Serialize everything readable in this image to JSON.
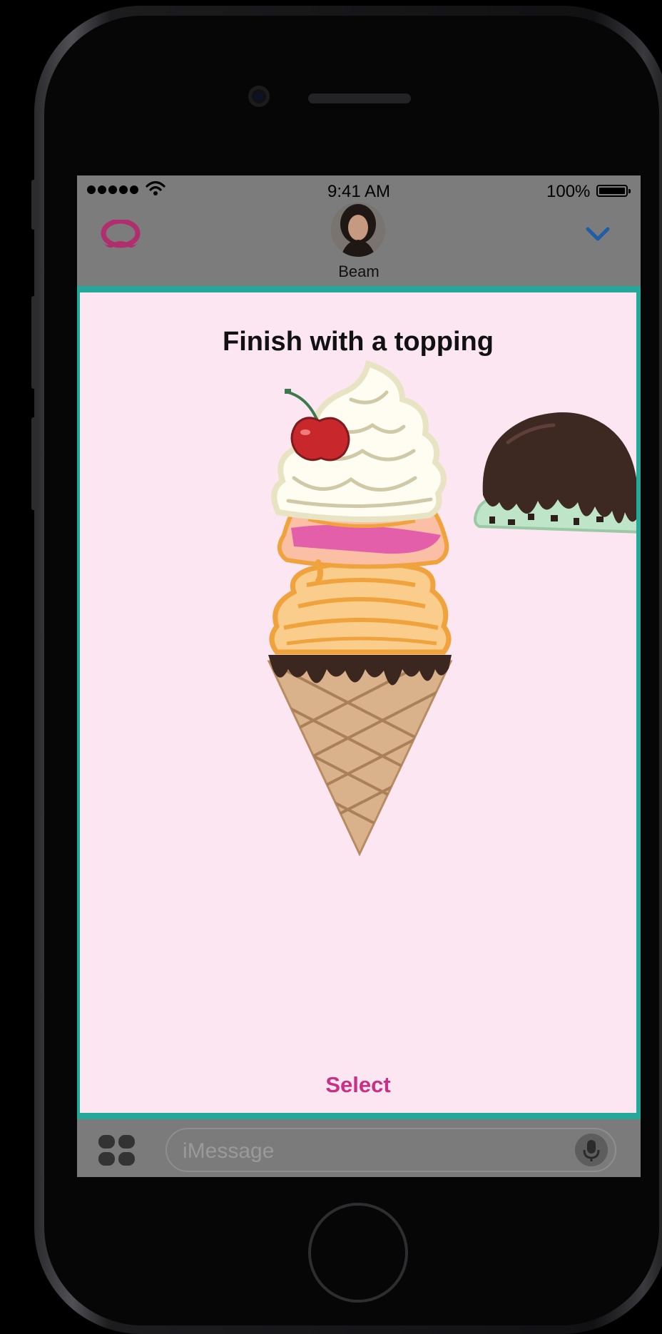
{
  "status_bar": {
    "time": "9:41 AM",
    "battery": "100%"
  },
  "header": {
    "contact_name": "Beam"
  },
  "panel": {
    "title": "Finish with a topping",
    "select_label": "Select"
  },
  "input_bar": {
    "placeholder": "iMessage"
  },
  "icons": {
    "app": "mustache-app-icon",
    "collapse": "chevron-down-icon",
    "apps": "app-drawer-icon",
    "mic": "microphone-icon"
  },
  "colors": {
    "panel_bg": "#fbe6f2",
    "panel_border": "#24a89a",
    "accent": "#c93085",
    "chevron": "#1e5ea8"
  }
}
